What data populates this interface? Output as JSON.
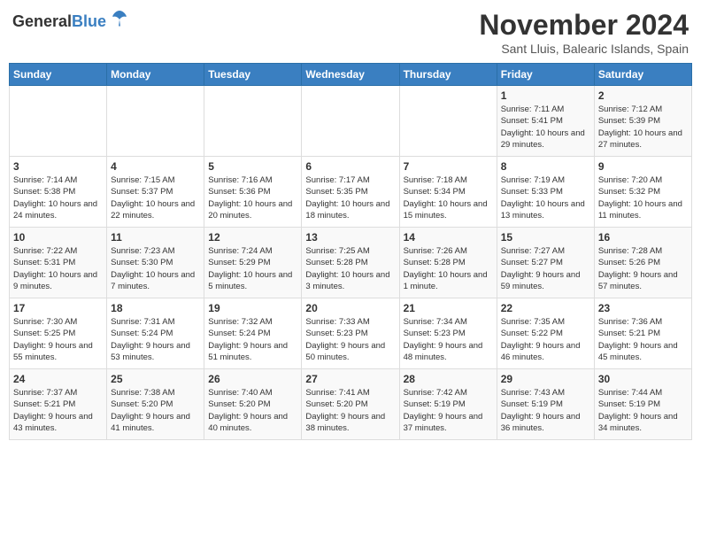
{
  "header": {
    "logo_general": "General",
    "logo_blue": "Blue",
    "month_title": "November 2024",
    "location": "Sant Lluis, Balearic Islands, Spain"
  },
  "weekdays": [
    "Sunday",
    "Monday",
    "Tuesday",
    "Wednesday",
    "Thursday",
    "Friday",
    "Saturday"
  ],
  "rows": [
    [
      {
        "day": "",
        "sunrise": "",
        "sunset": "",
        "daylight": ""
      },
      {
        "day": "",
        "sunrise": "",
        "sunset": "",
        "daylight": ""
      },
      {
        "day": "",
        "sunrise": "",
        "sunset": "",
        "daylight": ""
      },
      {
        "day": "",
        "sunrise": "",
        "sunset": "",
        "daylight": ""
      },
      {
        "day": "",
        "sunrise": "",
        "sunset": "",
        "daylight": ""
      },
      {
        "day": "1",
        "sunrise": "Sunrise: 7:11 AM",
        "sunset": "Sunset: 5:41 PM",
        "daylight": "Daylight: 10 hours and 29 minutes."
      },
      {
        "day": "2",
        "sunrise": "Sunrise: 7:12 AM",
        "sunset": "Sunset: 5:39 PM",
        "daylight": "Daylight: 10 hours and 27 minutes."
      }
    ],
    [
      {
        "day": "3",
        "sunrise": "Sunrise: 7:14 AM",
        "sunset": "Sunset: 5:38 PM",
        "daylight": "Daylight: 10 hours and 24 minutes."
      },
      {
        "day": "4",
        "sunrise": "Sunrise: 7:15 AM",
        "sunset": "Sunset: 5:37 PM",
        "daylight": "Daylight: 10 hours and 22 minutes."
      },
      {
        "day": "5",
        "sunrise": "Sunrise: 7:16 AM",
        "sunset": "Sunset: 5:36 PM",
        "daylight": "Daylight: 10 hours and 20 minutes."
      },
      {
        "day": "6",
        "sunrise": "Sunrise: 7:17 AM",
        "sunset": "Sunset: 5:35 PM",
        "daylight": "Daylight: 10 hours and 18 minutes."
      },
      {
        "day": "7",
        "sunrise": "Sunrise: 7:18 AM",
        "sunset": "Sunset: 5:34 PM",
        "daylight": "Daylight: 10 hours and 15 minutes."
      },
      {
        "day": "8",
        "sunrise": "Sunrise: 7:19 AM",
        "sunset": "Sunset: 5:33 PM",
        "daylight": "Daylight: 10 hours and 13 minutes."
      },
      {
        "day": "9",
        "sunrise": "Sunrise: 7:20 AM",
        "sunset": "Sunset: 5:32 PM",
        "daylight": "Daylight: 10 hours and 11 minutes."
      }
    ],
    [
      {
        "day": "10",
        "sunrise": "Sunrise: 7:22 AM",
        "sunset": "Sunset: 5:31 PM",
        "daylight": "Daylight: 10 hours and 9 minutes."
      },
      {
        "day": "11",
        "sunrise": "Sunrise: 7:23 AM",
        "sunset": "Sunset: 5:30 PM",
        "daylight": "Daylight: 10 hours and 7 minutes."
      },
      {
        "day": "12",
        "sunrise": "Sunrise: 7:24 AM",
        "sunset": "Sunset: 5:29 PM",
        "daylight": "Daylight: 10 hours and 5 minutes."
      },
      {
        "day": "13",
        "sunrise": "Sunrise: 7:25 AM",
        "sunset": "Sunset: 5:28 PM",
        "daylight": "Daylight: 10 hours and 3 minutes."
      },
      {
        "day": "14",
        "sunrise": "Sunrise: 7:26 AM",
        "sunset": "Sunset: 5:28 PM",
        "daylight": "Daylight: 10 hours and 1 minute."
      },
      {
        "day": "15",
        "sunrise": "Sunrise: 7:27 AM",
        "sunset": "Sunset: 5:27 PM",
        "daylight": "Daylight: 9 hours and 59 minutes."
      },
      {
        "day": "16",
        "sunrise": "Sunrise: 7:28 AM",
        "sunset": "Sunset: 5:26 PM",
        "daylight": "Daylight: 9 hours and 57 minutes."
      }
    ],
    [
      {
        "day": "17",
        "sunrise": "Sunrise: 7:30 AM",
        "sunset": "Sunset: 5:25 PM",
        "daylight": "Daylight: 9 hours and 55 minutes."
      },
      {
        "day": "18",
        "sunrise": "Sunrise: 7:31 AM",
        "sunset": "Sunset: 5:24 PM",
        "daylight": "Daylight: 9 hours and 53 minutes."
      },
      {
        "day": "19",
        "sunrise": "Sunrise: 7:32 AM",
        "sunset": "Sunset: 5:24 PM",
        "daylight": "Daylight: 9 hours and 51 minutes."
      },
      {
        "day": "20",
        "sunrise": "Sunrise: 7:33 AM",
        "sunset": "Sunset: 5:23 PM",
        "daylight": "Daylight: 9 hours and 50 minutes."
      },
      {
        "day": "21",
        "sunrise": "Sunrise: 7:34 AM",
        "sunset": "Sunset: 5:23 PM",
        "daylight": "Daylight: 9 hours and 48 minutes."
      },
      {
        "day": "22",
        "sunrise": "Sunrise: 7:35 AM",
        "sunset": "Sunset: 5:22 PM",
        "daylight": "Daylight: 9 hours and 46 minutes."
      },
      {
        "day": "23",
        "sunrise": "Sunrise: 7:36 AM",
        "sunset": "Sunset: 5:21 PM",
        "daylight": "Daylight: 9 hours and 45 minutes."
      }
    ],
    [
      {
        "day": "24",
        "sunrise": "Sunrise: 7:37 AM",
        "sunset": "Sunset: 5:21 PM",
        "daylight": "Daylight: 9 hours and 43 minutes."
      },
      {
        "day": "25",
        "sunrise": "Sunrise: 7:38 AM",
        "sunset": "Sunset: 5:20 PM",
        "daylight": "Daylight: 9 hours and 41 minutes."
      },
      {
        "day": "26",
        "sunrise": "Sunrise: 7:40 AM",
        "sunset": "Sunset: 5:20 PM",
        "daylight": "Daylight: 9 hours and 40 minutes."
      },
      {
        "day": "27",
        "sunrise": "Sunrise: 7:41 AM",
        "sunset": "Sunset: 5:20 PM",
        "daylight": "Daylight: 9 hours and 38 minutes."
      },
      {
        "day": "28",
        "sunrise": "Sunrise: 7:42 AM",
        "sunset": "Sunset: 5:19 PM",
        "daylight": "Daylight: 9 hours and 37 minutes."
      },
      {
        "day": "29",
        "sunrise": "Sunrise: 7:43 AM",
        "sunset": "Sunset: 5:19 PM",
        "daylight": "Daylight: 9 hours and 36 minutes."
      },
      {
        "day": "30",
        "sunrise": "Sunrise: 7:44 AM",
        "sunset": "Sunset: 5:19 PM",
        "daylight": "Daylight: 9 hours and 34 minutes."
      }
    ]
  ]
}
